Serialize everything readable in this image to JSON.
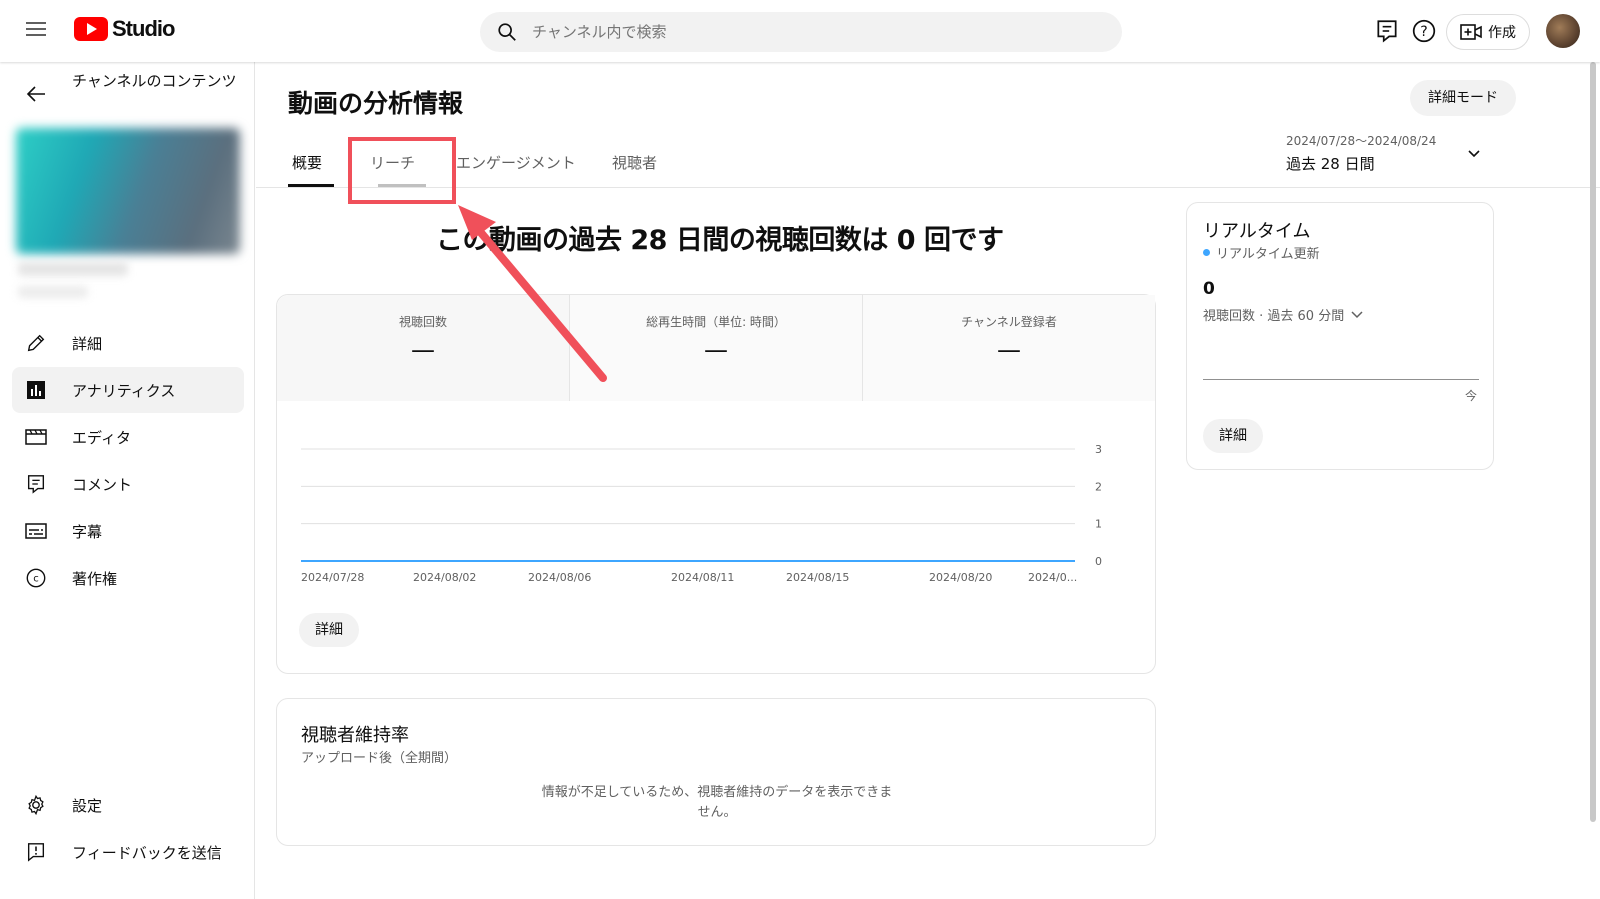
{
  "header": {
    "logo_text": "Studio",
    "search_placeholder": "チャンネル内で検索",
    "create_label": "作成"
  },
  "sidebar": {
    "title": "チャンネルのコンテンツ",
    "items": [
      {
        "label": "詳細",
        "icon": "pencil-icon"
      },
      {
        "label": "アナリティクス",
        "icon": "analytics-icon",
        "active": true
      },
      {
        "label": "エディタ",
        "icon": "editor-icon"
      },
      {
        "label": "コメント",
        "icon": "comment-icon"
      },
      {
        "label": "字幕",
        "icon": "subtitles-icon"
      },
      {
        "label": "著作権",
        "icon": "copyright-icon"
      }
    ],
    "bottom_items": [
      {
        "label": "設定",
        "icon": "gear-icon"
      },
      {
        "label": "フィードバックを送信",
        "icon": "feedback-icon"
      }
    ]
  },
  "main": {
    "title": "動画の分析情報",
    "detail_mode_label": "詳細モード",
    "tabs": [
      {
        "label": "概要",
        "active": true
      },
      {
        "label": "リーチ"
      },
      {
        "label": "エンゲージメント"
      },
      {
        "label": "視聴者"
      }
    ],
    "date_range": {
      "range": "2024/07/28〜2024/08/24",
      "label": "過去 28 日間"
    },
    "headline": "この動画の過去 28 日間の視聴回数は 0 回です",
    "metrics": [
      {
        "label": "視聴回数",
        "value": "—"
      },
      {
        "label": "総再生時間（単位: 時間）",
        "value": "—"
      },
      {
        "label": "チャンネル登録者",
        "value": "—"
      }
    ],
    "detail_button": "詳細",
    "retention": {
      "title": "視聴者維持率",
      "subtitle": "アップロード後（全期間）",
      "message_line1": "情報が不足しているため、視聴者維持のデータを表示できま",
      "message_line2": "せん。"
    }
  },
  "realtime": {
    "title": "リアルタイム",
    "subtitle": "リアルタイム更新",
    "value": "0",
    "metric_label": "視聴回数 · 過去 60 分間",
    "now_label": "今",
    "detail_button": "詳細",
    "accent_color": "#3ea6ff"
  },
  "annotation": {
    "highlight_color": "#f0505a"
  },
  "chart_data": {
    "type": "line",
    "x": [
      "2024/07/28",
      "2024/08/02",
      "2024/08/06",
      "2024/08/11",
      "2024/08/15",
      "2024/08/20",
      "2024/0..."
    ],
    "series": [
      {
        "values": [
          0,
          0,
          0,
          0,
          0,
          0,
          0
        ]
      }
    ],
    "yticks": [
      "0",
      "1",
      "2",
      "3"
    ],
    "ylim": [
      0,
      3
    ],
    "grid": true,
    "line_color": "#3ea6ff"
  }
}
